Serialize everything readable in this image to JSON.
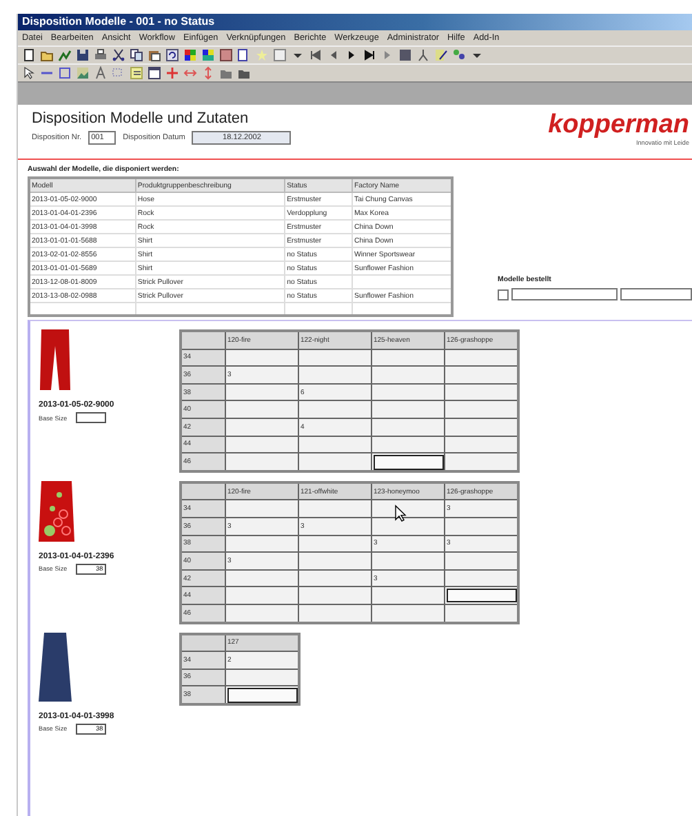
{
  "window": {
    "title": "Disposition Modelle - 001 - no Status"
  },
  "menu": [
    "Datei",
    "Bearbeiten",
    "Ansicht",
    "Workflow",
    "Einfügen",
    "Verknüpfungen",
    "Berichte",
    "Werkzeuge",
    "Administrator",
    "Hilfe",
    "Add-In"
  ],
  "header": {
    "title": "Disposition Modelle und Zutaten",
    "nr_label": "Disposition Nr.",
    "nr_value": "001",
    "date_label": "Disposition Datum",
    "date_value": "18.12.2002",
    "logo": "kopperman",
    "logo_tagline": "Innovatio mit Leide"
  },
  "selection": {
    "caption": "Auswahl der Modelle, die disponiert werden:",
    "columns": [
      "Modell",
      "Produktgruppenbeschreibung",
      "Status",
      "Factory Name"
    ],
    "rows": [
      {
        "modell": "2013-01-05-02-9000",
        "gruppe": "Hose",
        "status": "Erstmuster",
        "factory": "Tai Chung Canvas"
      },
      {
        "modell": "2013-01-04-01-2396",
        "gruppe": "Rock",
        "status": "Verdopplung",
        "factory": "Max Korea"
      },
      {
        "modell": "2013-01-04-01-3998",
        "gruppe": "Rock",
        "status": "Erstmuster",
        "factory": "China Down"
      },
      {
        "modell": "2013-01-01-01-5688",
        "gruppe": "Shirt",
        "status": "Erstmuster",
        "factory": "China Down"
      },
      {
        "modell": "2013-02-01-02-8556",
        "gruppe": "Shirt",
        "status": "no Status",
        "factory": "Winner Sportswear"
      },
      {
        "modell": "2013-01-01-01-5689",
        "gruppe": "Shirt",
        "status": "no Status",
        "factory": "Sunflower Fashion"
      },
      {
        "modell": "2013-12-08-01-8009",
        "gruppe": "Strick Pullover",
        "status": "no Status"
      },
      {
        "modell": "2013-13-08-02-0988",
        "gruppe": "Strick Pullover",
        "status": "no Status",
        "factory": "Sunflower Fashion"
      }
    ]
  },
  "ordered": {
    "label": "Modelle bestellt",
    "checked": false
  },
  "models": [
    {
      "kind": "pants",
      "code": "2013-01-05-02-9000",
      "base_size_label": "Base Size",
      "columns": [
        "120-fire",
        "122-night",
        "125-heaven",
        "126-grashoppe"
      ],
      "rows": [
        {
          "size": "34",
          "cells": [
            {
              "selected": false
            },
            {
              "selected": false
            },
            {
              "selected": false
            },
            {
              "selected": false
            }
          ]
        },
        {
          "size": "36",
          "cells": [
            {
              "value": "3",
              "selected": false
            },
            {
              "selected": false
            },
            {
              "selected": false
            },
            {
              "selected": false
            }
          ]
        },
        {
          "size": "38",
          "cells": [
            {
              "selected": false
            },
            {
              "value": "6",
              "selected": false
            },
            {
              "selected": false
            },
            {
              "selected": false
            }
          ]
        },
        {
          "size": "40",
          "cells": [
            {
              "selected": false
            },
            {
              "selected": false
            },
            {
              "selected": false
            },
            {
              "selected": false
            }
          ]
        },
        {
          "size": "42",
          "cells": [
            {
              "selected": false
            },
            {
              "value": "4",
              "selected": false
            },
            {
              "selected": false
            },
            {
              "selected": false
            }
          ]
        },
        {
          "size": "44",
          "cells": [
            {
              "selected": false
            },
            {
              "selected": false
            },
            {
              "selected": false
            },
            {
              "selected": false
            }
          ]
        },
        {
          "size": "46",
          "cells": [
            {
              "selected": false
            },
            {
              "selected": false
            },
            {
              "selected": true
            },
            {
              "selected": false
            }
          ]
        }
      ]
    },
    {
      "kind": "skirt-flowers",
      "code": "2013-01-04-01-2396",
      "base_size_label": "Base Size",
      "base_size": "38",
      "columns": [
        "120-fire",
        "121-offwhite",
        "123-honeymoo",
        "126-grashoppe"
      ],
      "rows": [
        {
          "size": "34",
          "cells": [
            {
              "selected": false
            },
            {
              "selected": false
            },
            {
              "selected": false
            },
            {
              "value": "3",
              "selected": false
            }
          ]
        },
        {
          "size": "36",
          "cells": [
            {
              "value": "3",
              "selected": false
            },
            {
              "value": "3",
              "selected": false
            },
            {
              "selected": false
            },
            {
              "selected": false
            }
          ]
        },
        {
          "size": "38",
          "cells": [
            {
              "selected": false
            },
            {
              "selected": false
            },
            {
              "value": "3",
              "selected": false
            },
            {
              "value": "3",
              "selected": false
            }
          ]
        },
        {
          "size": "40",
          "cells": [
            {
              "value": "3",
              "selected": false
            },
            {
              "selected": false
            },
            {
              "selected": false
            },
            {
              "selected": false
            }
          ]
        },
        {
          "size": "42",
          "cells": [
            {
              "selected": false
            },
            {
              "selected": false
            },
            {
              "value": "3",
              "selected": false
            },
            {
              "selected": false
            }
          ]
        },
        {
          "size": "44",
          "cells": [
            {
              "selected": false
            },
            {
              "selected": false
            },
            {
              "selected": false
            },
            {
              "selected": true
            }
          ]
        },
        {
          "size": "46",
          "cells": [
            {
              "selected": false
            },
            {
              "selected": false
            },
            {
              "selected": false
            },
            {
              "selected": false
            }
          ]
        }
      ]
    },
    {
      "kind": "skirt-dark",
      "code": "2013-01-04-01-3998",
      "base_size_label": "Base Size",
      "base_size": "38",
      "columns": [
        "127"
      ],
      "rows": [
        {
          "size": "34",
          "cells": [
            {
              "value": "2",
              "selected": false
            }
          ]
        },
        {
          "size": "36",
          "cells": [
            {
              "selected": false
            }
          ]
        },
        {
          "size": "38",
          "cells": [
            {
              "selected": true
            }
          ]
        }
      ]
    }
  ]
}
